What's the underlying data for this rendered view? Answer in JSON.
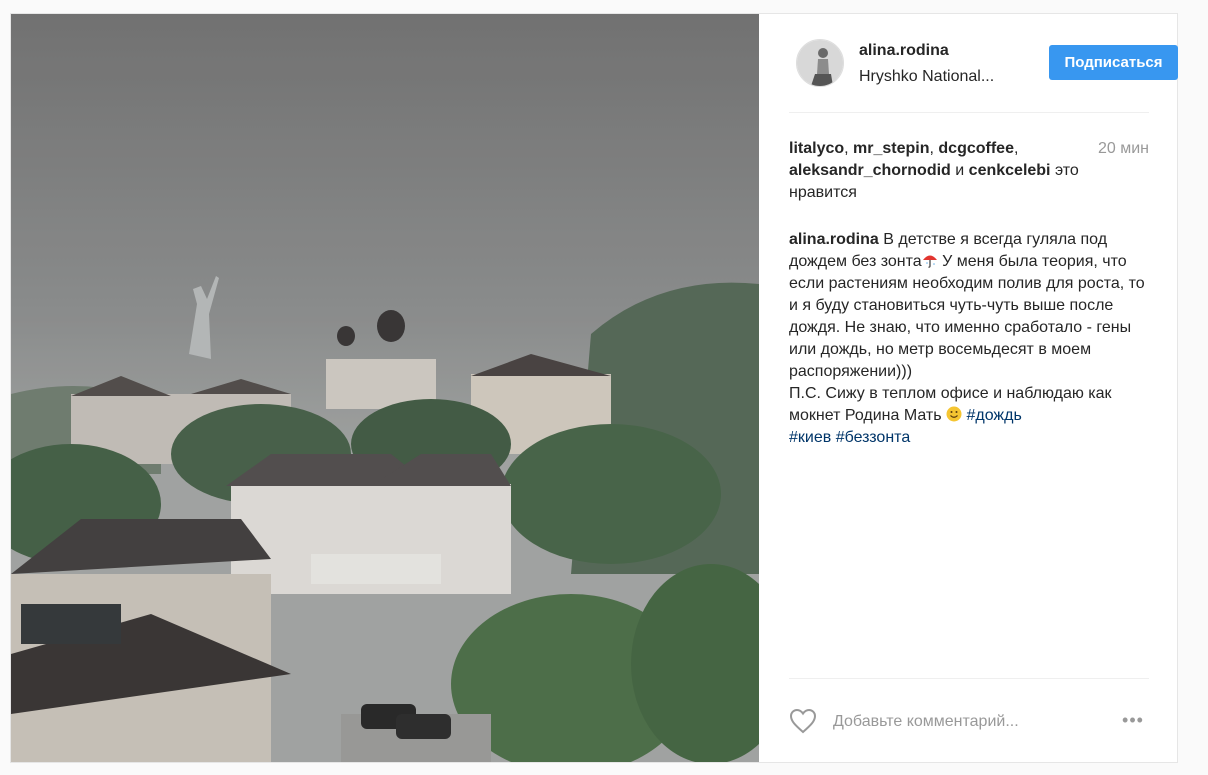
{
  "post": {
    "username": "alina.rodina",
    "location": "Hryshko National...",
    "follow_label": "Подписаться",
    "likes": {
      "users": [
        "litalyco",
        "mr_stepin",
        "dcgcoffee",
        "aleksandr_chornodid",
        "cenkcelebi"
      ],
      "sep1": ", ",
      "sep2": ", ",
      "sep3": ",",
      "and_word": " и",
      "suffix": " это нравится",
      "time": "20 мин"
    },
    "caption": {
      "author": "alina.rodina",
      "part1": " В детстве я всегда гуляла под дождем без зонта",
      "part2": " У меня была теория, что если растениям необходим полив для роста, то и я буду становиться чуть-чуть выше после дождя. Не знаю, что именно сработало - гены или дождь, но метр восемьдесят в моем распоряжении)))",
      "part3": "П.С. Сижу в теплом офисе и наблюдаю как мокнет Родина Мать",
      "hashtags": [
        "#дождь",
        "#киев",
        "#беззонта"
      ]
    },
    "comment_placeholder": "Добавьте комментарий...",
    "more_label": "•••"
  },
  "colors": {
    "accent": "#3897f0",
    "tag": "#003569",
    "muted": "#999999"
  },
  "icons": {
    "like": "heart-outline-icon",
    "more": "more-dots-icon",
    "umbrella": "umbrella-emoji",
    "smile": "smile-emoji"
  }
}
